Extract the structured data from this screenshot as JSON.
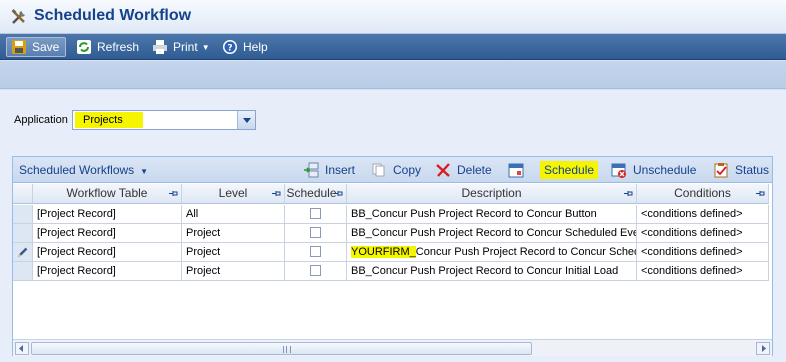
{
  "window": {
    "title": "Scheduled Workflow"
  },
  "toolbar": {
    "save_label": "Save",
    "refresh_label": "Refresh",
    "print_label": "Print",
    "help_label": "Help"
  },
  "application": {
    "label": "Application",
    "selected": "Projects"
  },
  "grid": {
    "title": "Scheduled Workflows",
    "buttons": {
      "insert": "Insert",
      "copy": "Copy",
      "delete": "Delete",
      "schedule": "Schedule",
      "unschedule": "Unschedule",
      "status": "Status"
    },
    "columns": [
      "Workflow Table",
      "Level",
      "Schedule",
      "Description",
      "Conditions"
    ],
    "rows": [
      {
        "table": "[Project Record]",
        "level": "All",
        "schedule": false,
        "description": "BB_Concur Push Project Record to Concur Button",
        "conditions": "<conditions defined>"
      },
      {
        "table": "[Project Record]",
        "level": "Project",
        "schedule": false,
        "description": "BB_Concur Push Project Record to Concur Scheduled Eve",
        "conditions": "<conditions defined>"
      },
      {
        "table": "[Project Record]",
        "level": "Project",
        "schedule": false,
        "description_highlight": "YOURFIRM_",
        "description_rest": "Concur Push Project Record to Concur Schedul",
        "conditions": "<conditions defined>"
      },
      {
        "table": "[Project Record]",
        "level": "Project",
        "schedule": false,
        "description": "BB_Concur Push Project Record to Concur Initial Load",
        "conditions": "<conditions defined>"
      }
    ]
  },
  "colors": {
    "toolbar": "#2f5c93",
    "highlight": "#f5f500",
    "header_text": "#15428b"
  }
}
